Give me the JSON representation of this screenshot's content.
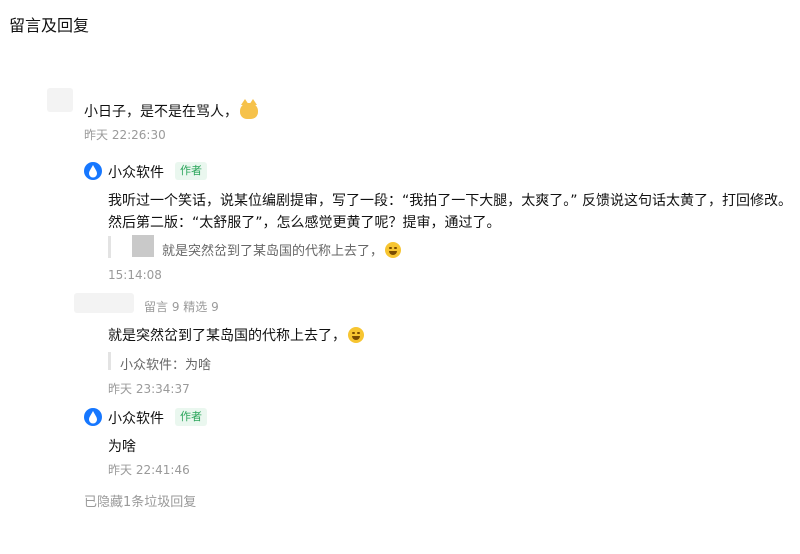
{
  "page_title": "留言及回复",
  "thread1": {
    "comment": {
      "text": "小日子，是不是在骂人，",
      "emoji": "cat-face-icon",
      "time": "昨天 22:26:30"
    },
    "reply": {
      "author": "小众软件",
      "tag": "作者",
      "line1": "我听过一个笑话，说某位编剧提审，写了一段：“我拍了一下大腿，太爽了。” 反馈说这句话太黄了，打回修改。",
      "line2": "然后第二版：“太舒服了”，怎么感觉更黄了呢？提审，通过了。",
      "quote": "就是突然岔到了某岛国的代称上去了，",
      "time": "15:14:08"
    }
  },
  "thread2": {
    "comment": {
      "meta": "留言 9 精选 9",
      "text": "就是突然岔到了某岛国的代称上去了，",
      "quote": "小众软件：为啥",
      "time": "昨天 23:34:37"
    },
    "reply": {
      "author": "小众软件",
      "tag": "作者",
      "text": "为啥",
      "time": "昨天 22:41:46"
    }
  },
  "footer": {
    "hidden_text": "已隐藏1条垃圾回复"
  },
  "colors": {
    "author_tag": "#2aa55a",
    "logo_blue": "#1677ff",
    "timestamp": "#9a9a9a"
  }
}
